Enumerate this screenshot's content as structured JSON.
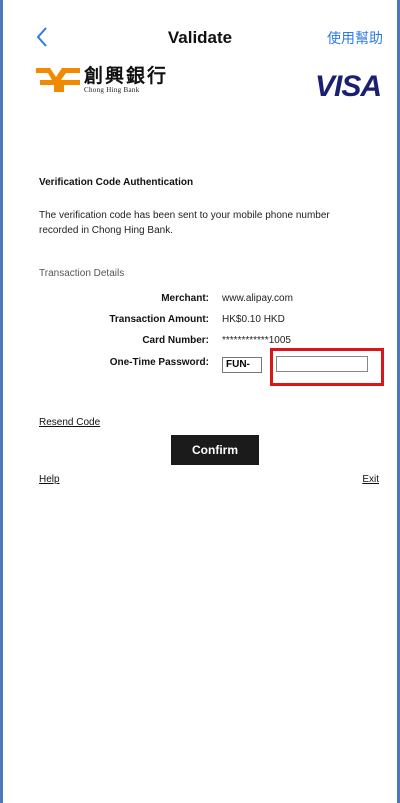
{
  "header": {
    "title": "Validate",
    "help_label": "使用幫助",
    "back_icon": "chevron-left-icon"
  },
  "logos": {
    "bank_name_cn": "創興銀行",
    "bank_name_en": "Chong Hing Bank",
    "visa": "VISA"
  },
  "auth": {
    "title": "Verification Code Authentication",
    "message": "The verification code has been sent to your mobile phone number recorded in Chong Hing Bank."
  },
  "details": {
    "heading": "Transaction Details",
    "merchant_label": "Merchant:",
    "merchant_value": "www.alipay.com",
    "amount_label": "Transaction Amount:",
    "amount_value": "HK$0.10 HKD",
    "card_label": "Card Number:",
    "card_value": "************1005",
    "otp_label": "One-Time Password:",
    "otp_prefix": "FUN-",
    "otp_value": ""
  },
  "actions": {
    "resend_label": "Resend Code",
    "confirm_label": "Confirm",
    "help_label": "Help",
    "exit_label": "Exit"
  },
  "colors": {
    "accent_blue": "#2f7ae5",
    "highlight_red": "#d9161c",
    "confirm_bg": "#1b1b1b",
    "bank_orange": "#f08a00",
    "visa_blue": "#1a1f71"
  }
}
